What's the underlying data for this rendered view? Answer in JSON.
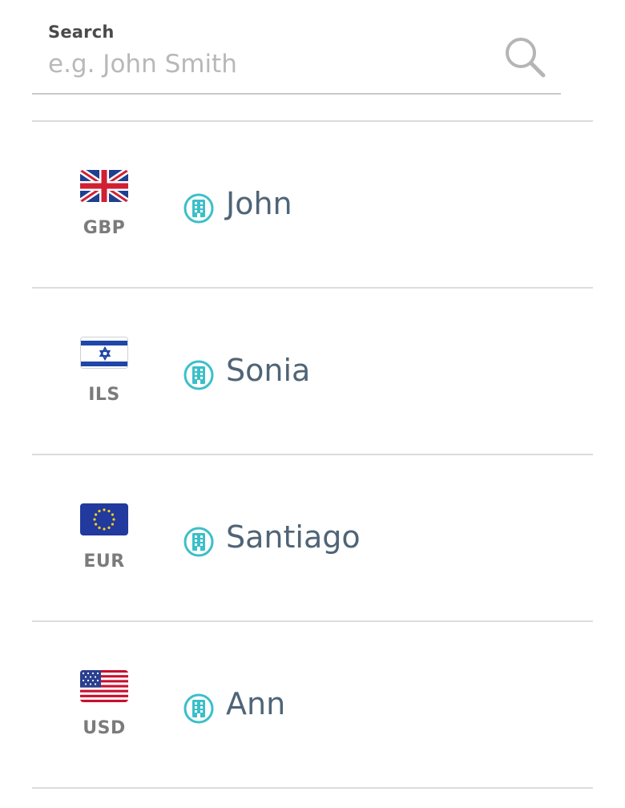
{
  "search": {
    "label": "Search",
    "placeholder": "e.g. John Smith",
    "value": ""
  },
  "contacts": [
    {
      "name": "John",
      "currency": "GBP",
      "flag_icon": "uk-flag-icon",
      "type_icon": "building-icon"
    },
    {
      "name": "Sonia",
      "currency": "ILS",
      "flag_icon": "israel-flag-icon",
      "type_icon": "building-icon"
    },
    {
      "name": "Santiago",
      "currency": "EUR",
      "flag_icon": "eu-flag-icon",
      "type_icon": "building-icon"
    },
    {
      "name": "Ann",
      "currency": "USD",
      "flag_icon": "us-flag-icon",
      "type_icon": "building-icon"
    }
  ],
  "colors": {
    "name_text": "#4f6477",
    "currency_text": "#7b7b7b",
    "building_icon": "#3bbfc9",
    "divider": "#dcdcdc"
  }
}
